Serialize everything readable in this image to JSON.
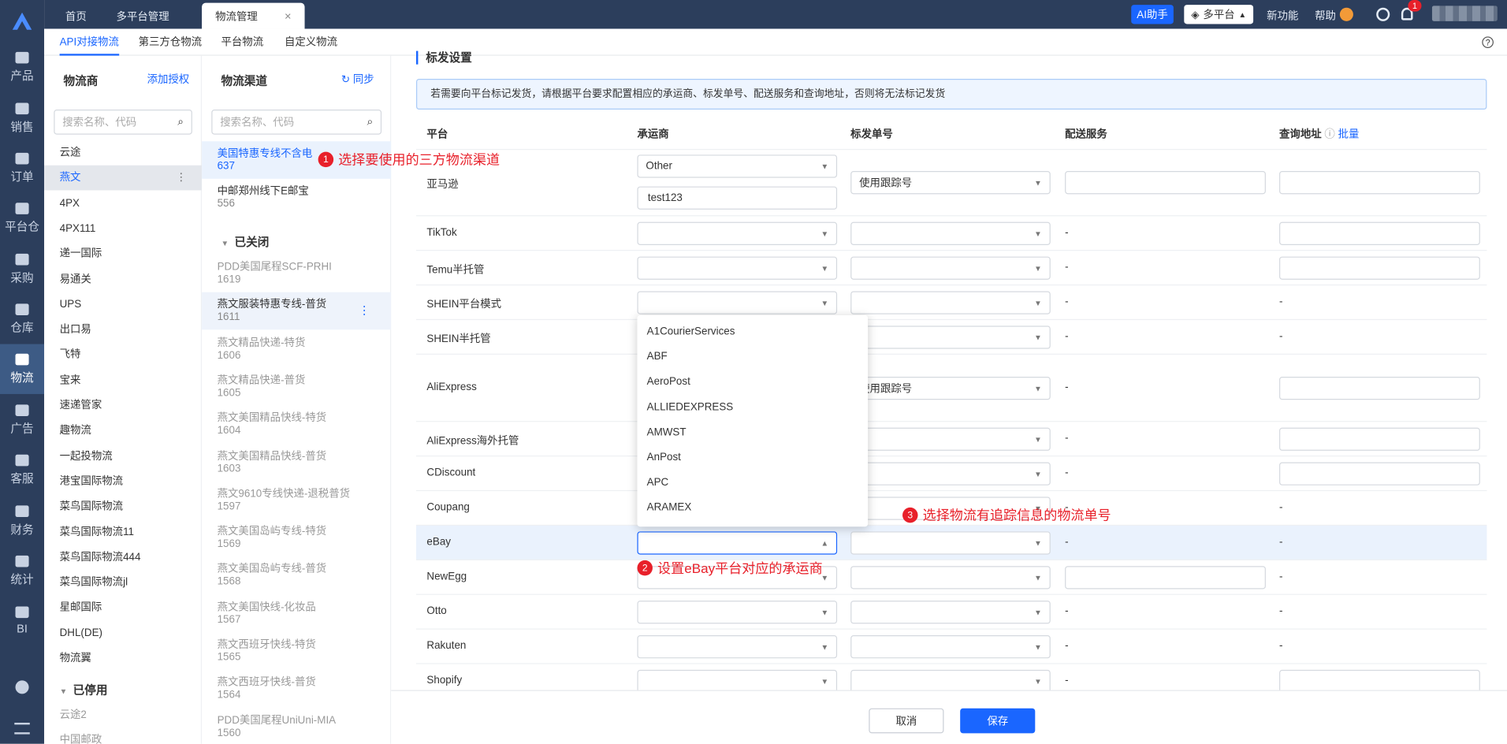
{
  "nav": {
    "items": [
      "产品",
      "销售",
      "订单",
      "平台仓",
      "采购",
      "仓库",
      "物流",
      "广告",
      "客服",
      "财务",
      "统计",
      "BI"
    ]
  },
  "topbar": {
    "tabs": [
      "首页",
      "多平台管理",
      "物流管理"
    ],
    "close": "×",
    "ai": "AI助手",
    "platform": "多平台",
    "new_feature": "新功能",
    "help": "帮助",
    "badge": "1"
  },
  "subtabs": [
    "API对接物流",
    "第三方仓物流",
    "平台物流",
    "自定义物流"
  ],
  "carriers": {
    "title": "物流商",
    "add": "添加授权",
    "search": "搜索名称、代码",
    "items": [
      "云途",
      "燕文",
      "4PX",
      "4PX111",
      "递一国际",
      "易通关",
      "UPS",
      "出口易",
      "飞特",
      "宝来",
      "速递管家",
      "趣物流",
      "一起投物流",
      "港宝国际物流",
      "菜鸟国际物流",
      "菜鸟国际物流11",
      "菜鸟国际物流444",
      "菜鸟国际物流jl",
      "星邮国际",
      "DHL(DE)",
      "物流翼"
    ],
    "disabled_title": "已停用",
    "disabled": [
      "云途2",
      "中国邮政"
    ]
  },
  "channels": {
    "title": "物流渠道",
    "sync": "同步",
    "search": "搜索名称、代码",
    "open": [
      {
        "name": "美国特惠专线不含电",
        "code": "637"
      },
      {
        "name": "中邮郑州线下E邮宝",
        "code": "556"
      }
    ],
    "closed_title": "已关闭",
    "closed": [
      {
        "name": "PDD美国尾程SCF-PRHI",
        "code": "1619"
      },
      {
        "name": "燕文服装特惠专线-普货",
        "code": "1611"
      },
      {
        "name": "燕文精品快递-特货",
        "code": "1606"
      },
      {
        "name": "燕文精品快递-普货",
        "code": "1605"
      },
      {
        "name": "燕文美国精品快线-特货",
        "code": "1604"
      },
      {
        "name": "燕文美国精品快线-普货",
        "code": "1603"
      },
      {
        "name": "燕文9610专线快递-退税普货",
        "code": "1597"
      },
      {
        "name": "燕文美国岛屿专线-特货",
        "code": "1569"
      },
      {
        "name": "燕文美国岛屿专线-普货",
        "code": "1568"
      },
      {
        "name": "燕文美国快线-化妆品",
        "code": "1567"
      },
      {
        "name": "燕文西班牙快线-特货",
        "code": "1565"
      },
      {
        "name": "燕文西班牙快线-普货",
        "code": "1564"
      },
      {
        "name": "PDD美国尾程UniUni-MIA",
        "code": "1560"
      }
    ]
  },
  "main": {
    "section": "标发设置",
    "tip": "若需要向平台标记发货，请根据平台要求配置相应的承运商、标发单号、配送服务和查询地址，否则将无法标记发货",
    "headers": {
      "platform": "平台",
      "carrier": "承运商",
      "tracking": "标发单号",
      "service": "配送服务",
      "query": "查询地址",
      "batch": "批量"
    },
    "amazon": {
      "platform": "亚马逊",
      "carrier": "Other",
      "carrier_other": "test123",
      "tracking": "使用跟踪号"
    },
    "aliexpress_tracking": "使用跟踪号",
    "platforms": [
      "TikTok",
      "Temu半托管",
      "SHEIN平台模式",
      "SHEIN半托管",
      "AliExpress",
      "AliExpress海外托管",
      "CDiscount",
      "Coupang",
      "eBay",
      "NewEgg",
      "Otto",
      "Rakuten",
      "Shopify"
    ],
    "dash": "-",
    "carrier_options": [
      "A1CourierServices",
      "ABF",
      "AeroPost",
      "ALLIEDEXPRESS",
      "AMWST",
      "AnPost",
      "APC",
      "ARAMEX"
    ],
    "cancel": "取消",
    "save": "保存"
  },
  "annotations": [
    {
      "num": "1",
      "text": "选择要使用的三方物流渠道"
    },
    {
      "num": "2",
      "text": "设置eBay平台对应的承运商"
    },
    {
      "num": "3",
      "text": "选择物流有追踪信息的物流单号"
    }
  ],
  "colors": {
    "sidebar": "#2c3e5c",
    "accent": "#1a66ff",
    "annotation": "#e8202a"
  }
}
